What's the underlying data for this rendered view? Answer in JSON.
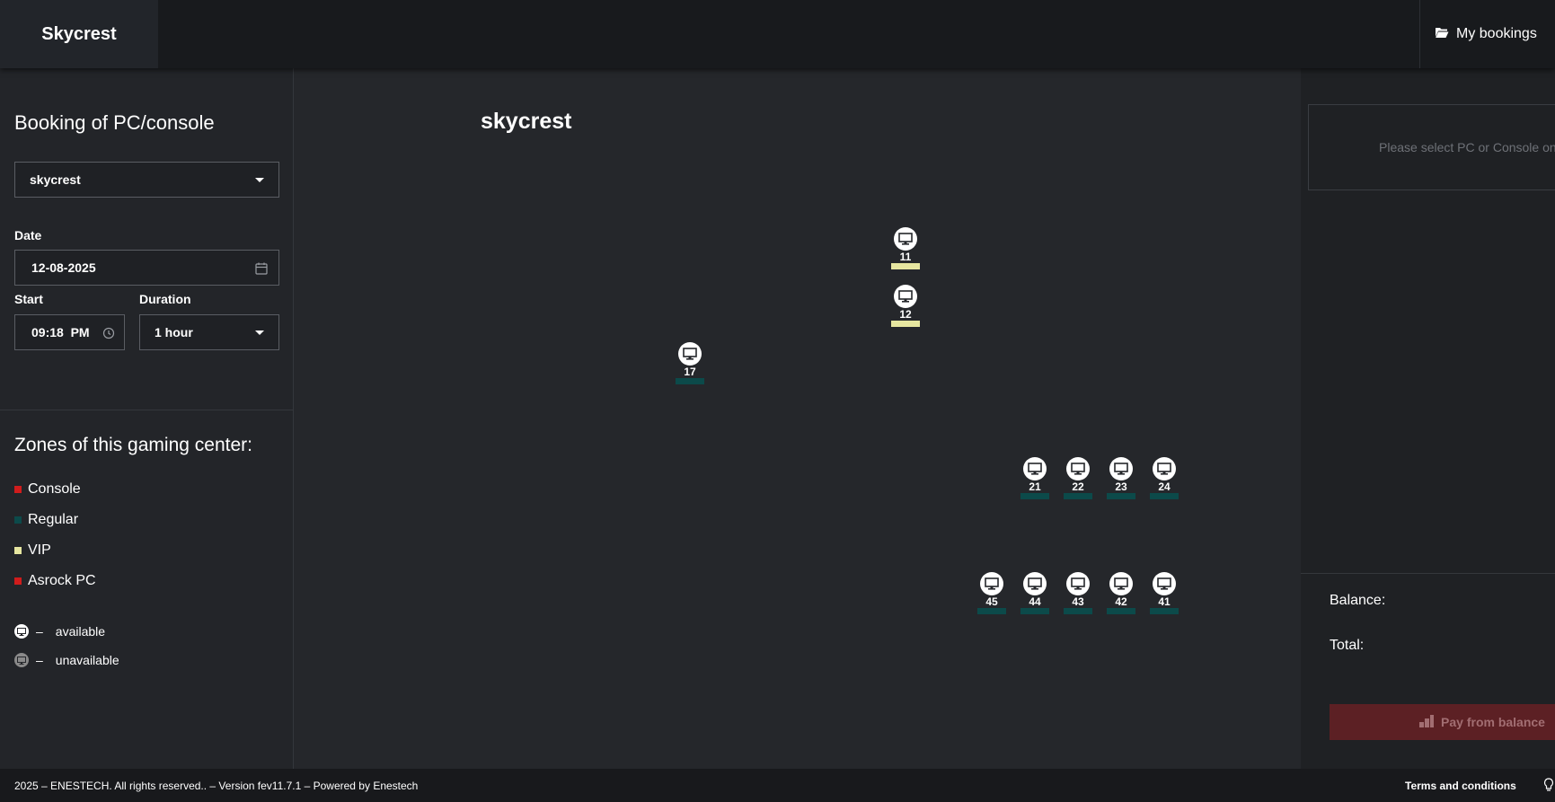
{
  "header": {
    "brand": "Skycrest",
    "my_bookings": "My bookings"
  },
  "sidebar": {
    "title": "Booking of PC/console",
    "club_select": "skycrest",
    "date_label": "Date",
    "date_value": "12-08-2025",
    "start_label": "Start",
    "start_value": "09:18  PM",
    "duration_label": "Duration",
    "duration_value": "1 hour",
    "zones_title": "Zones of this gaming center:",
    "zones": [
      {
        "name": "Console",
        "color": "#d01c1c"
      },
      {
        "name": "Regular",
        "color": "#0c4a4a"
      },
      {
        "name": "VIP",
        "color": "#e6e6a0"
      },
      {
        "name": "Asrock PC",
        "color": "#d01c1c"
      }
    ],
    "legend": [
      {
        "symbol": "–",
        "text": "available",
        "icon": "monitor-icon",
        "color": "#ffffff"
      },
      {
        "symbol": "–",
        "text": "unavailable",
        "icon": "monitor-icon",
        "color": "#8a8a8a"
      }
    ]
  },
  "map": {
    "title": "skycrest",
    "pcs": [
      {
        "number": "11",
        "zone": "VIP",
        "zone_color": "#e6e6a0"
      },
      {
        "number": "12",
        "zone": "VIP",
        "zone_color": "#e6e6a0"
      },
      {
        "number": "17",
        "zone": "Regular",
        "zone_color": "#0c4a4a"
      },
      {
        "number": "21",
        "zone": "Regular",
        "zone_color": "#0c4a4a"
      },
      {
        "number": "22",
        "zone": "Regular",
        "zone_color": "#0c4a4a"
      },
      {
        "number": "23",
        "zone": "Regular",
        "zone_color": "#0c4a4a"
      },
      {
        "number": "24",
        "zone": "Regular",
        "zone_color": "#0c4a4a"
      },
      {
        "number": "45",
        "zone": "Regular",
        "zone_color": "#0c4a4a"
      },
      {
        "number": "44",
        "zone": "Regular",
        "zone_color": "#0c4a4a"
      },
      {
        "number": "43",
        "zone": "Regular",
        "zone_color": "#0c4a4a"
      },
      {
        "number": "42",
        "zone": "Regular",
        "zone_color": "#0c4a4a"
      },
      {
        "number": "41",
        "zone": "Regular",
        "zone_color": "#0c4a4a"
      }
    ]
  },
  "right_panel": {
    "placeholder": "Please select PC or Console on t",
    "balance_label": "Balance:",
    "total_label": "Total:",
    "pay_button": "Pay from balance"
  },
  "footer": {
    "copyright": "2025 – ENESTECH. All rights reserved.. – Version fev11.7.1 – Powered by Enestech",
    "terms": "Terms and conditions"
  }
}
